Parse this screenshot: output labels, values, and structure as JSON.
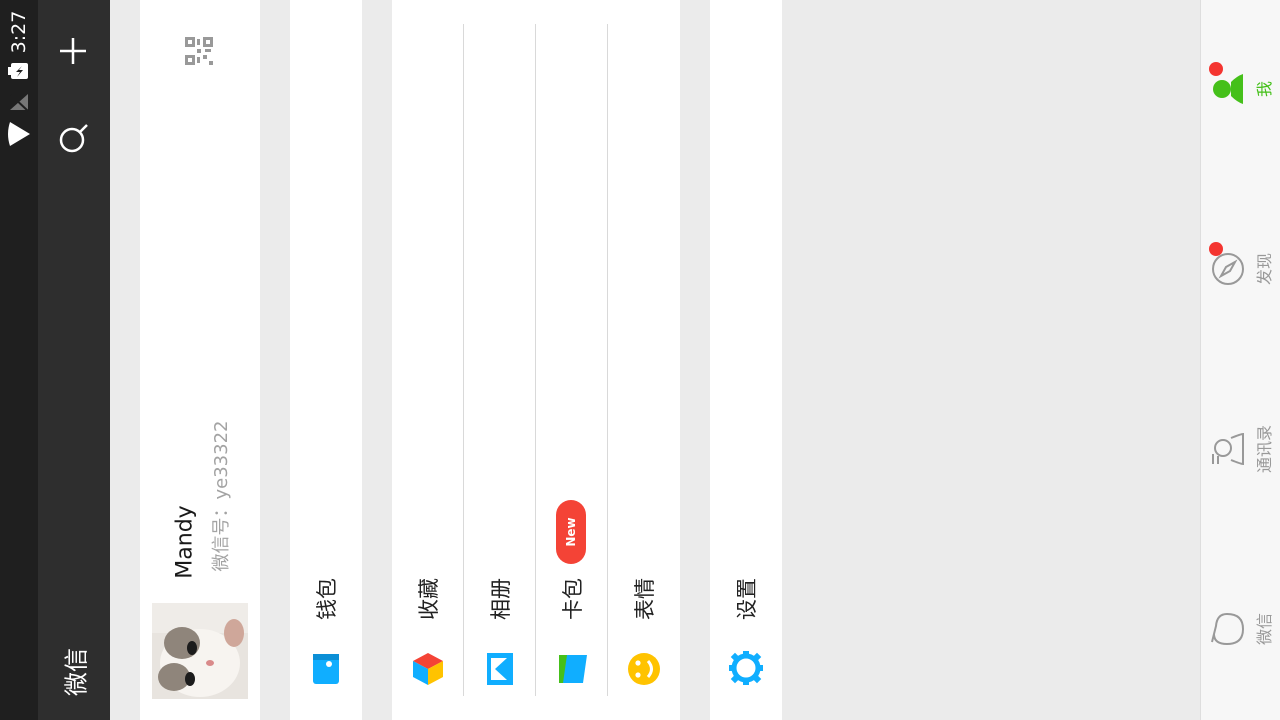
{
  "status": {
    "time": "3:27"
  },
  "header": {
    "title": "微信"
  },
  "profile": {
    "name": "Mandy",
    "wechat_id": "微信号：ye33322"
  },
  "menu": {
    "wallet": "钱包",
    "favorites": "收藏",
    "album": "相册",
    "cards": "卡包",
    "cards_badge": "New",
    "stickers": "表情",
    "settings": "设置"
  },
  "tabs": {
    "me": "我",
    "discover": "发现",
    "contacts": "通讯录",
    "chats": "微信"
  },
  "colors": {
    "accent_green": "#45c01a",
    "badge_red": "#f44336",
    "icon_blue": "#10aeff",
    "icon_yellow": "#ffc300"
  }
}
